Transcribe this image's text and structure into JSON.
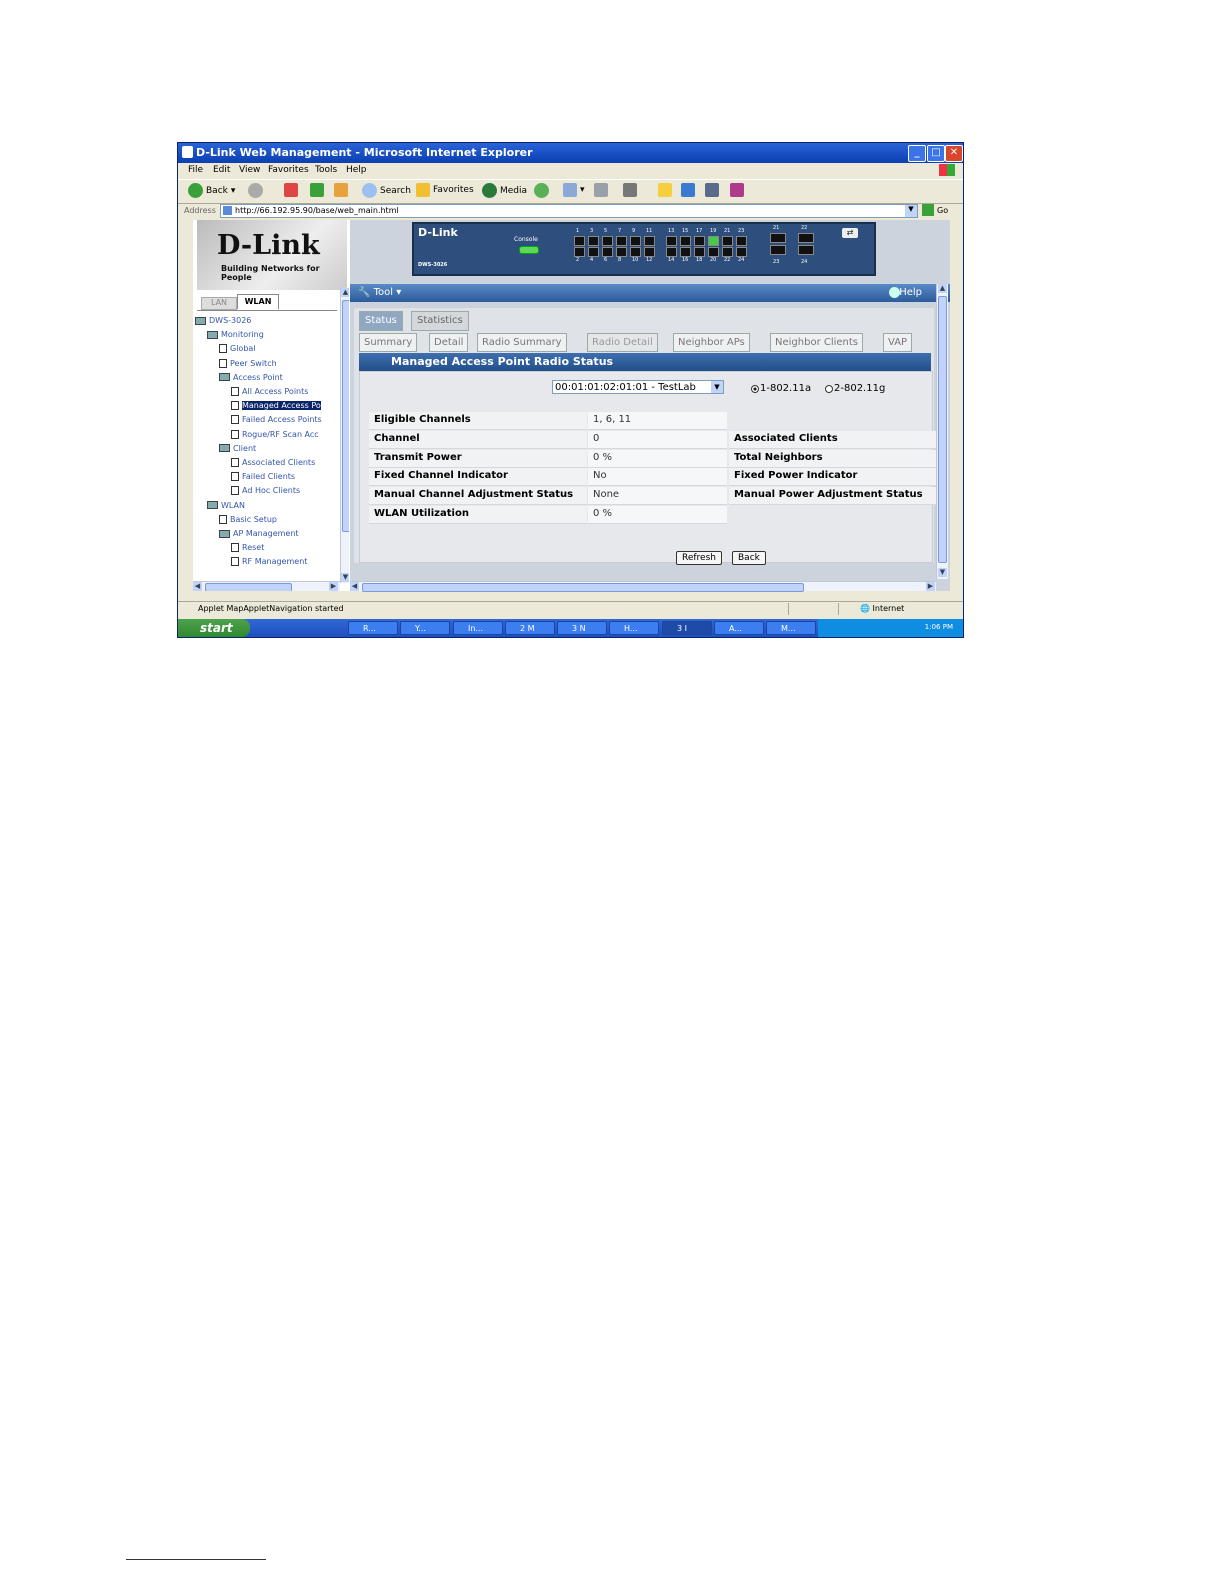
{
  "window": {
    "title": "D-Link Web Management - Microsoft Internet Explorer"
  },
  "menu": [
    "File",
    "Edit",
    "View",
    "Favorites",
    "Tools",
    "Help"
  ],
  "toolbar": {
    "back": "Back",
    "search": "Search",
    "favorites": "Favorites",
    "media": "Media"
  },
  "address": {
    "label": "Address",
    "url": "http://66.192.95.90/base/web_main.html",
    "go": "Go"
  },
  "logo": {
    "brand": "D-Link",
    "tagline": "Building Networks for People"
  },
  "nav_tabs": {
    "lan": "LAN",
    "wlan": "WLAN"
  },
  "tree": [
    {
      "label": "DWS-3026",
      "kind": "folder",
      "level": 0
    },
    {
      "label": "Monitoring",
      "kind": "folder",
      "level": 1
    },
    {
      "label": "Global",
      "kind": "page",
      "level": 2
    },
    {
      "label": "Peer Switch",
      "kind": "page",
      "level": 2
    },
    {
      "label": "Access Point",
      "kind": "folder",
      "level": 2
    },
    {
      "label": "All Access Points",
      "kind": "page",
      "level": 3
    },
    {
      "label": "Managed Access Po",
      "kind": "page",
      "level": 3,
      "selected": true
    },
    {
      "label": "Failed Access Points",
      "kind": "page",
      "level": 3
    },
    {
      "label": "Rogue/RF Scan Acc",
      "kind": "page",
      "level": 3
    },
    {
      "label": "Client",
      "kind": "folder",
      "level": 2
    },
    {
      "label": "Associated Clients",
      "kind": "page",
      "level": 3
    },
    {
      "label": "Failed Clients",
      "kind": "page",
      "level": 3
    },
    {
      "label": "Ad Hoc Clients",
      "kind": "page",
      "level": 3
    },
    {
      "label": "WLAN",
      "kind": "folder",
      "level": 1
    },
    {
      "label": "Basic Setup",
      "kind": "page",
      "level": 2
    },
    {
      "label": "AP Management",
      "kind": "folder",
      "level": 2
    },
    {
      "label": "Reset",
      "kind": "page",
      "level": 3
    },
    {
      "label": "RF Management",
      "kind": "page",
      "level": 3
    }
  ],
  "device": {
    "brand": "D-Link",
    "model": "DWS-3026",
    "console_label": "Console",
    "ports_top": [
      "1",
      "3",
      "5",
      "7",
      "9",
      "11",
      "13",
      "15",
      "17",
      "19",
      "21",
      "23"
    ],
    "ports_bottom": [
      "2",
      "4",
      "6",
      "8",
      "10",
      "12",
      "14",
      "16",
      "18",
      "20",
      "22",
      "24"
    ],
    "uplink_top": [
      "21",
      "22"
    ],
    "uplink_bottom": [
      "23",
      "24"
    ],
    "active_port": "19"
  },
  "app_toolbar": {
    "tool": "Tool",
    "help": "Help"
  },
  "top_tabs": [
    {
      "label": "Status",
      "active": true
    },
    {
      "label": "Statistics",
      "active": false
    }
  ],
  "sub_tabs": [
    {
      "label": "Summary",
      "active": false
    },
    {
      "label": "Detail",
      "active": false
    },
    {
      "label": "Radio Summary",
      "active": false
    },
    {
      "label": "Radio Detail",
      "active": true
    },
    {
      "label": "Neighbor APs",
      "active": false
    },
    {
      "label": "Neighbor Clients",
      "active": false
    },
    {
      "label": "VAP",
      "active": false
    }
  ],
  "section": {
    "title": "Managed Access Point Radio Status"
  },
  "ap_select": {
    "value": "00:01:01:02:01:01 - TestLab"
  },
  "radios": [
    {
      "label": "1-802.11a",
      "checked": true
    },
    {
      "label": "2-802.11g",
      "checked": false
    }
  ],
  "rows": [
    {
      "label": "Eligible Channels",
      "value": "1, 6, 11",
      "label2": ""
    },
    {
      "label": "Channel",
      "value": "0",
      "label2": "Associated Clients"
    },
    {
      "label": "Transmit Power",
      "value": "0 %",
      "label2": "Total Neighbors"
    },
    {
      "label": "Fixed Channel Indicator",
      "value": "No",
      "label2": "Fixed Power Indicator"
    },
    {
      "label": "Manual Channel Adjustment Status",
      "value": "None",
      "label2": "Manual Power Adjustment Status"
    },
    {
      "label": "WLAN Utilization",
      "value": "0 %",
      "label2": ""
    }
  ],
  "buttons": {
    "refresh": "Refresh",
    "back": "Back"
  },
  "statusbar": {
    "message": "Applet MapAppletNavigation started",
    "zone": "Internet"
  },
  "taskbar": {
    "start": "start",
    "tasks": [
      "R...",
      "Y...",
      "In...",
      "2 M",
      "3 N",
      "H...",
      "3 I",
      "A...",
      "M..."
    ],
    "clock": "1:06 PM"
  }
}
